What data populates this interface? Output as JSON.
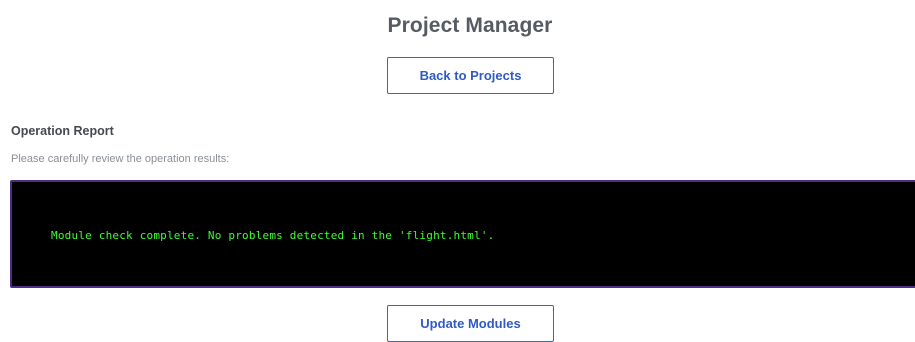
{
  "header": {
    "title": "Project Manager",
    "back_button_label": "Back to Projects"
  },
  "report": {
    "heading": "Operation Report",
    "description": "Please carefully review the operation results:",
    "output_text": "Module check complete. No problems detected in the 'flight.html'.",
    "output_text_color": "#3cff2e",
    "output_background": "#000000",
    "output_border_color": "#4b2c86"
  },
  "actions": {
    "update_button_label": "Update Modules"
  },
  "colors": {
    "accent": "#2f5bc4",
    "title": "#555a63",
    "muted_text": "#8a8f97"
  }
}
